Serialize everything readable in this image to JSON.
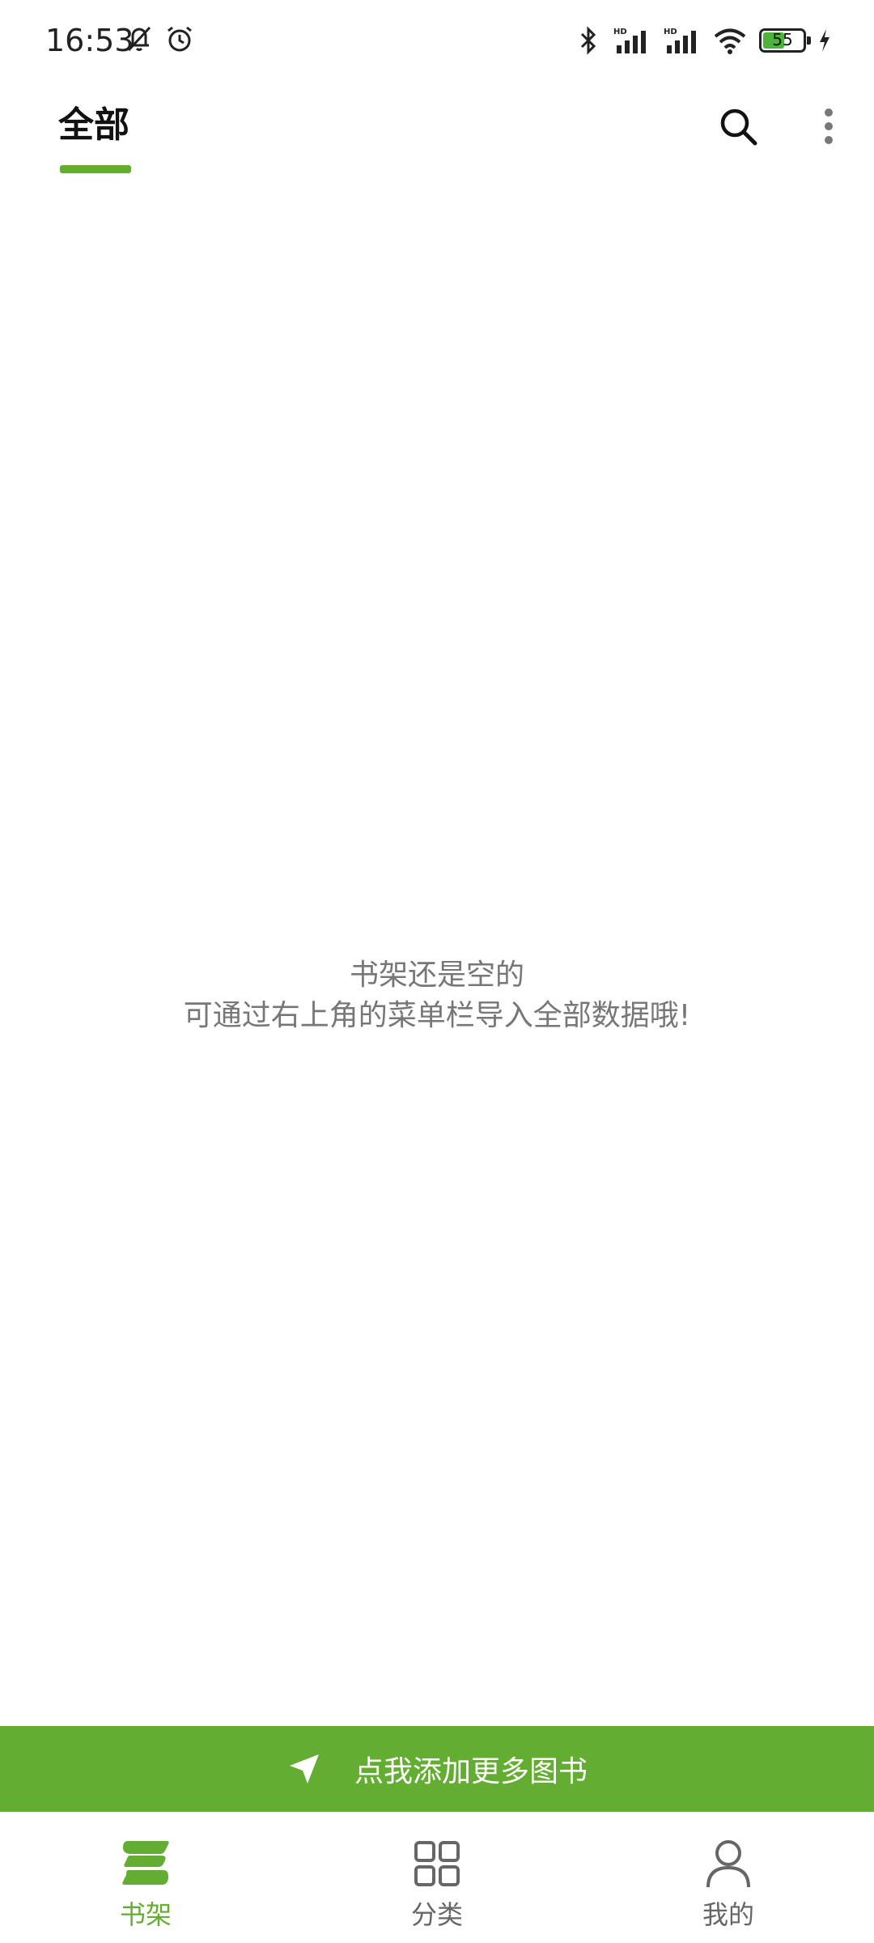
{
  "status_bar": {
    "time": "16:53",
    "battery_level": "55",
    "icons": [
      "mute-bell-icon",
      "alarm-icon",
      "bluetooth-icon",
      "hd-signal-icon",
      "hd-signal-icon",
      "wifi-icon",
      "battery-icon",
      "charging-icon"
    ]
  },
  "top_bar": {
    "tab_label": "全部",
    "search_icon": "search-icon",
    "more_icon": "more-vertical-icon"
  },
  "empty_state": {
    "line1": "书架还是空的",
    "line2": "可通过右上角的菜单栏导入全部数据哦!"
  },
  "add_banner": {
    "label": "点我添加更多图书",
    "icon": "send-arrow-icon"
  },
  "bottom_nav": {
    "items": [
      {
        "label": "书架",
        "icon": "bookshelf-icon",
        "active": true
      },
      {
        "label": "分类",
        "icon": "grid-icon",
        "active": false
      },
      {
        "label": "我的",
        "icon": "profile-icon",
        "active": false
      }
    ]
  },
  "colors": {
    "accent": "#63ad32",
    "text_primary": "#111111",
    "text_secondary": "#777777",
    "nav_inactive": "#666666",
    "background": "#ffffff"
  }
}
